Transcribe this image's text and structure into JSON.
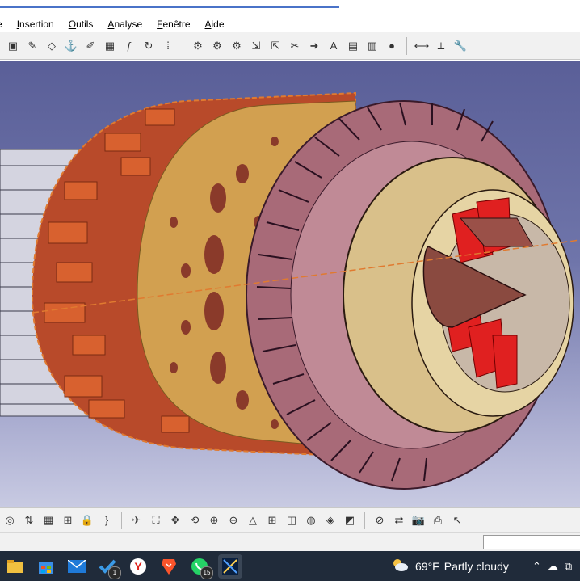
{
  "menu": {
    "items": [
      {
        "label": "e",
        "accent": ""
      },
      {
        "label": "Insertion",
        "accent": "I"
      },
      {
        "label": "Outils",
        "accent": "O"
      },
      {
        "label": "Analyse",
        "accent": "A"
      },
      {
        "label": "Fenêtre",
        "accent": "F"
      },
      {
        "label": "Aide",
        "accent": "A"
      }
    ]
  },
  "toolbar_top": {
    "icons": [
      "part-body-icon",
      "sketch-tool-icon",
      "plane-icon",
      "anchor-icon",
      "pencil-icon",
      "grid-icon",
      "formula-icon",
      "refresh-icon",
      "dots-matrix-icon",
      "gear-settings-icon",
      "gear-update-icon",
      "gear-axis-icon",
      "insert-arrow-icon",
      "export-arrow-icon",
      "scissors-icon",
      "arrow-right-icon",
      "font-icon",
      "catalog-icon",
      "manage-icon",
      "sphere-icon",
      "measure-between-icon",
      "measure-item-icon",
      "wrench-icon"
    ]
  },
  "toolbar_bottom": {
    "icons": [
      "compass-icon",
      "sort-icon",
      "table-icon",
      "tree-icon",
      "lock-icon",
      "bracket-icon",
      "fly-mode-icon",
      "fit-all-icon",
      "pan-icon",
      "rotate-icon",
      "zoom-in-icon",
      "zoom-out-icon",
      "normal-view-icon",
      "multi-view-icon",
      "iso-view-icon",
      "shading-icon",
      "apply-material-icon",
      "render-icon",
      "hide-show-icon",
      "swap-icon",
      "camera-icon",
      "print-icon",
      "cursor-icon"
    ]
  },
  "taskbar": {
    "apps": [
      {
        "icon": "file-explorer-icon",
        "badge": ""
      },
      {
        "icon": "store-icon",
        "badge": ""
      },
      {
        "icon": "mail-icon",
        "badge": ""
      },
      {
        "icon": "todo-check-icon",
        "badge": "1"
      },
      {
        "icon": "yandex-browser-icon",
        "badge": ""
      },
      {
        "icon": "brave-browser-icon",
        "badge": ""
      },
      {
        "icon": "whatsapp-icon",
        "badge": "15"
      },
      {
        "icon": "catia-app-icon",
        "badge": ""
      }
    ],
    "weather": {
      "temperature": "69°F",
      "condition": "Partly cloudy"
    }
  },
  "colors": {
    "viewport_top": "#5a5f98",
    "viewport_bottom": "#c8cae2",
    "casing_red": "#b84a2a",
    "casing_gold": "#d2a050",
    "nozzle_brown": "#8a4a40",
    "fan_red": "#e02020"
  }
}
